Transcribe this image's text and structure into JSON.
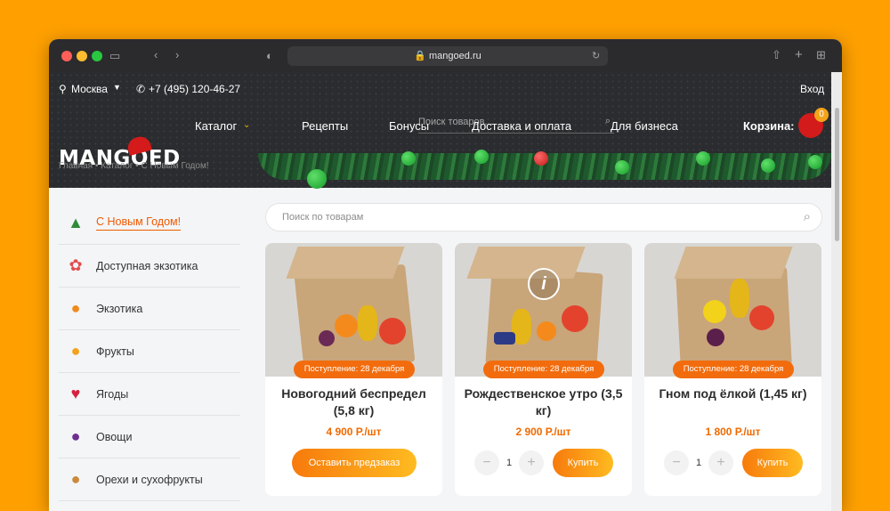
{
  "browser": {
    "url": "mangoed.ru"
  },
  "header": {
    "city": "Москва",
    "phone": "+7 (495) 120-46-27",
    "search_placeholder": "Поиск товаров...",
    "login": "Вход",
    "logo_text": "MANGOED",
    "nav": [
      "Каталог",
      "Рецепты",
      "Бонусы",
      "Доставка и оплата",
      "Для бизнеса"
    ],
    "cart_label": "Корзина:",
    "cart_count": "0"
  },
  "breadcrumb": "Главная • Каталог • С Новым Годом!",
  "sidebar": {
    "items": [
      {
        "label": "С Новым Годом!",
        "icon": "tree-icon",
        "active": true
      },
      {
        "label": "Доступная экзотика",
        "icon": "exotic-icon"
      },
      {
        "label": "Экзотика",
        "icon": "papaya-icon"
      },
      {
        "label": "Фрукты",
        "icon": "fruit-icon"
      },
      {
        "label": "Ягоды",
        "icon": "berry-icon"
      },
      {
        "label": "Овощи",
        "icon": "vegetable-icon"
      },
      {
        "label": "Орехи и сухофрукты",
        "icon": "nuts-icon"
      }
    ]
  },
  "product_search_placeholder": "Поиск по товарам",
  "products": [
    {
      "badge": "Поступление: 28 декабря",
      "title": "Новогодний беспредел (5,8 кг)",
      "price": "4 900 Р./шт",
      "button": "Оставить предзаказ"
    },
    {
      "badge": "Поступление: 28 декабря",
      "title": "Рождественское утро (3,5 кг)",
      "price": "2 900 Р./шт",
      "qty": "1",
      "button": "Купить"
    },
    {
      "badge": "Поступление: 28 декабря",
      "title": "Гном под ёлкой (1,45 кг)",
      "price": "1 800 Р./шт",
      "qty": "1",
      "button": "Купить"
    }
  ],
  "colors": {
    "accent": "#f26c0d",
    "header_bg": "#2a2c2f",
    "page_bg": "#ffa000"
  }
}
